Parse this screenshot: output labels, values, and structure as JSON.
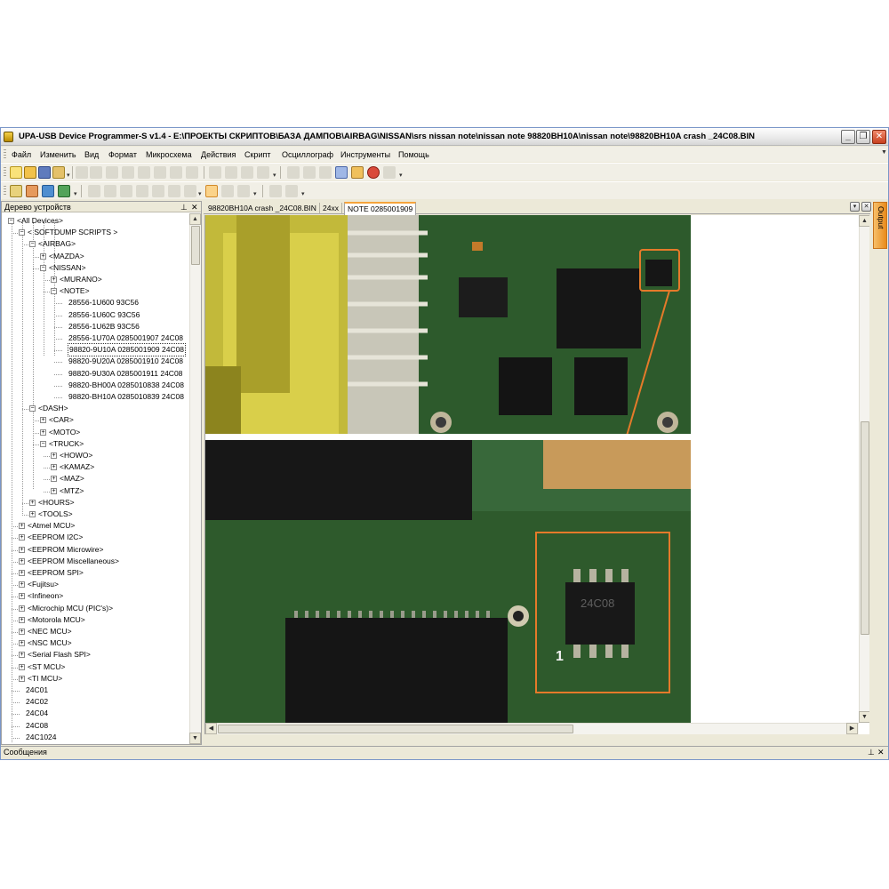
{
  "window": {
    "title": "UPA-USB Device Programmer-S v1.4 - E:\\ПРОЕКТЫ СКРИПТОВ\\БАЗА ДАМПОВ\\AIRBAG\\NISSAN\\srs nissan note\\nissan note 98820BH10A\\nissan note\\98820BH10A crash _24C08.BIN",
    "minimize_glyph": "_",
    "restore_glyph": "❐",
    "close_glyph": "✕"
  },
  "menu": [
    "Файл",
    "Изменить",
    "Вид",
    "Формат",
    "Микросхема",
    "Действия",
    "Скрипт",
    "Осциллограф",
    "Инструменты",
    "Помощь"
  ],
  "tree_panel": {
    "title": "Дерево устройств",
    "pin_glyph": "⊥",
    "close_glyph": "✕",
    "rows": [
      {
        "label": "<All Devices>",
        "level": 0,
        "expander": "-"
      },
      {
        "label": "< SOFTDUMP SCRIPTS >",
        "level": 1,
        "expander": "-"
      },
      {
        "label": "<AIRBAG>",
        "level": 2,
        "expander": "-"
      },
      {
        "label": "<MAZDA>",
        "level": 3,
        "expander": "+"
      },
      {
        "label": "<NISSAN>",
        "level": 3,
        "expander": "-"
      },
      {
        "label": "<MURANO>",
        "level": 4,
        "expander": "+"
      },
      {
        "label": "<NOTE>",
        "level": 4,
        "expander": "-"
      },
      {
        "label": "28556-1U600 93C56",
        "level": 5,
        "expander": ""
      },
      {
        "label": "28556-1U60C 93C56",
        "level": 5,
        "expander": ""
      },
      {
        "label": "28556-1U62B 93C56",
        "level": 5,
        "expander": ""
      },
      {
        "label": "28556-1U70A 0285001907 24C08",
        "level": 5,
        "expander": ""
      },
      {
        "label": "98820-9U10A 0285001909 24C08",
        "level": 5,
        "expander": "",
        "selected": true
      },
      {
        "label": "98820-9U20A 0285001910 24C08",
        "level": 5,
        "expander": ""
      },
      {
        "label": "98820-9U30A 0285001911 24C08",
        "level": 5,
        "expander": ""
      },
      {
        "label": "98820-BH00A 0285010838 24C08",
        "level": 5,
        "expander": ""
      },
      {
        "label": "98820-BH10A 0285010839 24C08",
        "level": 5,
        "expander": ""
      },
      {
        "label": "<DASH>",
        "level": 2,
        "expander": "-"
      },
      {
        "label": "<CAR>",
        "level": 3,
        "expander": "+"
      },
      {
        "label": "<MOTO>",
        "level": 3,
        "expander": "+"
      },
      {
        "label": "<TRUCK>",
        "level": 3,
        "expander": "-"
      },
      {
        "label": "<HOWO>",
        "level": 4,
        "expander": "+"
      },
      {
        "label": "<KAMAZ>",
        "level": 4,
        "expander": "+"
      },
      {
        "label": "<MAZ>",
        "level": 4,
        "expander": "+"
      },
      {
        "label": "<MTZ>",
        "level": 4,
        "expander": "+"
      },
      {
        "label": "<HOURS>",
        "level": 2,
        "expander": "+"
      },
      {
        "label": "<TOOLS>",
        "level": 2,
        "expander": "+"
      },
      {
        "label": "<Atmel MCU>",
        "level": 1,
        "expander": "+"
      },
      {
        "label": "<EEPROM I2C>",
        "level": 1,
        "expander": "+"
      },
      {
        "label": "<EEPROM Microwire>",
        "level": 1,
        "expander": "+"
      },
      {
        "label": "<EEPROM Miscellaneous>",
        "level": 1,
        "expander": "+"
      },
      {
        "label": "<EEPROM SPI>",
        "level": 1,
        "expander": "+"
      },
      {
        "label": "<Fujitsu>",
        "level": 1,
        "expander": "+"
      },
      {
        "label": "<Infineon>",
        "level": 1,
        "expander": "+"
      },
      {
        "label": "<Microchip MCU (PIC's)>",
        "level": 1,
        "expander": "+"
      },
      {
        "label": "<Motorola MCU>",
        "level": 1,
        "expander": "+"
      },
      {
        "label": "<NEC MCU>",
        "level": 1,
        "expander": "+"
      },
      {
        "label": "<NSC MCU>",
        "level": 1,
        "expander": "+"
      },
      {
        "label": "<Serial Flash SPI>",
        "level": 1,
        "expander": "+"
      },
      {
        "label": "<ST MCU>",
        "level": 1,
        "expander": "+"
      },
      {
        "label": "<TI MCU>",
        "level": 1,
        "expander": "+"
      },
      {
        "label": "24C01",
        "level": 1,
        "expander": ""
      },
      {
        "label": "24C02",
        "level": 1,
        "expander": ""
      },
      {
        "label": "24C04",
        "level": 1,
        "expander": ""
      },
      {
        "label": "24C08",
        "level": 1,
        "expander": ""
      },
      {
        "label": "24C1024",
        "level": 1,
        "expander": ""
      }
    ]
  },
  "doc_tabs": [
    {
      "label": "98820BH10A crash _24C08.BIN",
      "active": false
    },
    {
      "label": "24xx",
      "active": false
    },
    {
      "label": "NOTE 0285001909",
      "active": true
    }
  ],
  "output_tab": "Output",
  "photo": {
    "chip_marking": "24C08",
    "pin_label": "1"
  },
  "status_bar": {
    "label": "Сообщения"
  },
  "colors": {
    "accent_orange": "#f6a43b",
    "window_bg": "#ece9d8",
    "pcb_green": "#2f5a2a"
  }
}
